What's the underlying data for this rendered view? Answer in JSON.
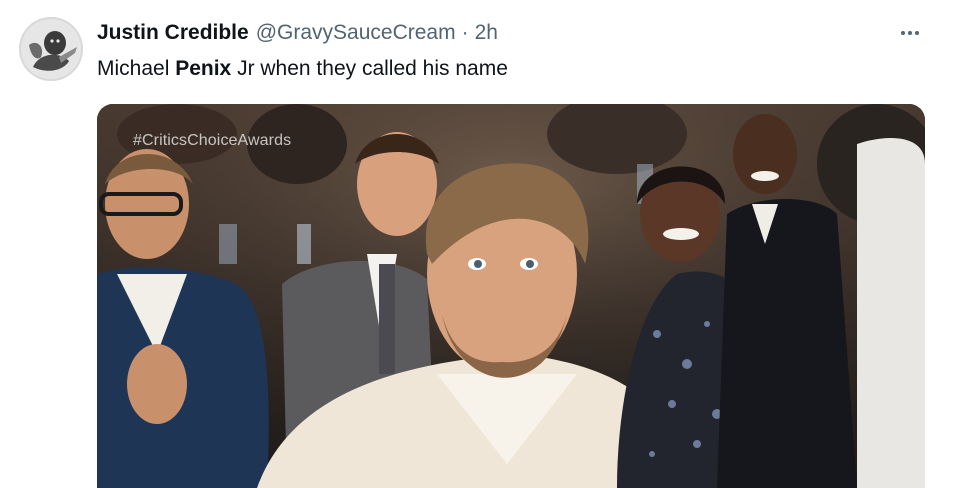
{
  "tweet": {
    "display_name": "Justin Credible",
    "handle": "@GravySauceCream",
    "separator": "·",
    "time": "2h",
    "more_icon": "more-horizontal-icon",
    "text_before": "Michael ",
    "text_bold": "Penix",
    "text_after": " Jr when they called his name"
  },
  "media": {
    "caption": "#CriticsChoiceAwards"
  },
  "colors": {
    "text_primary": "#0f1419",
    "text_secondary": "#536471"
  }
}
